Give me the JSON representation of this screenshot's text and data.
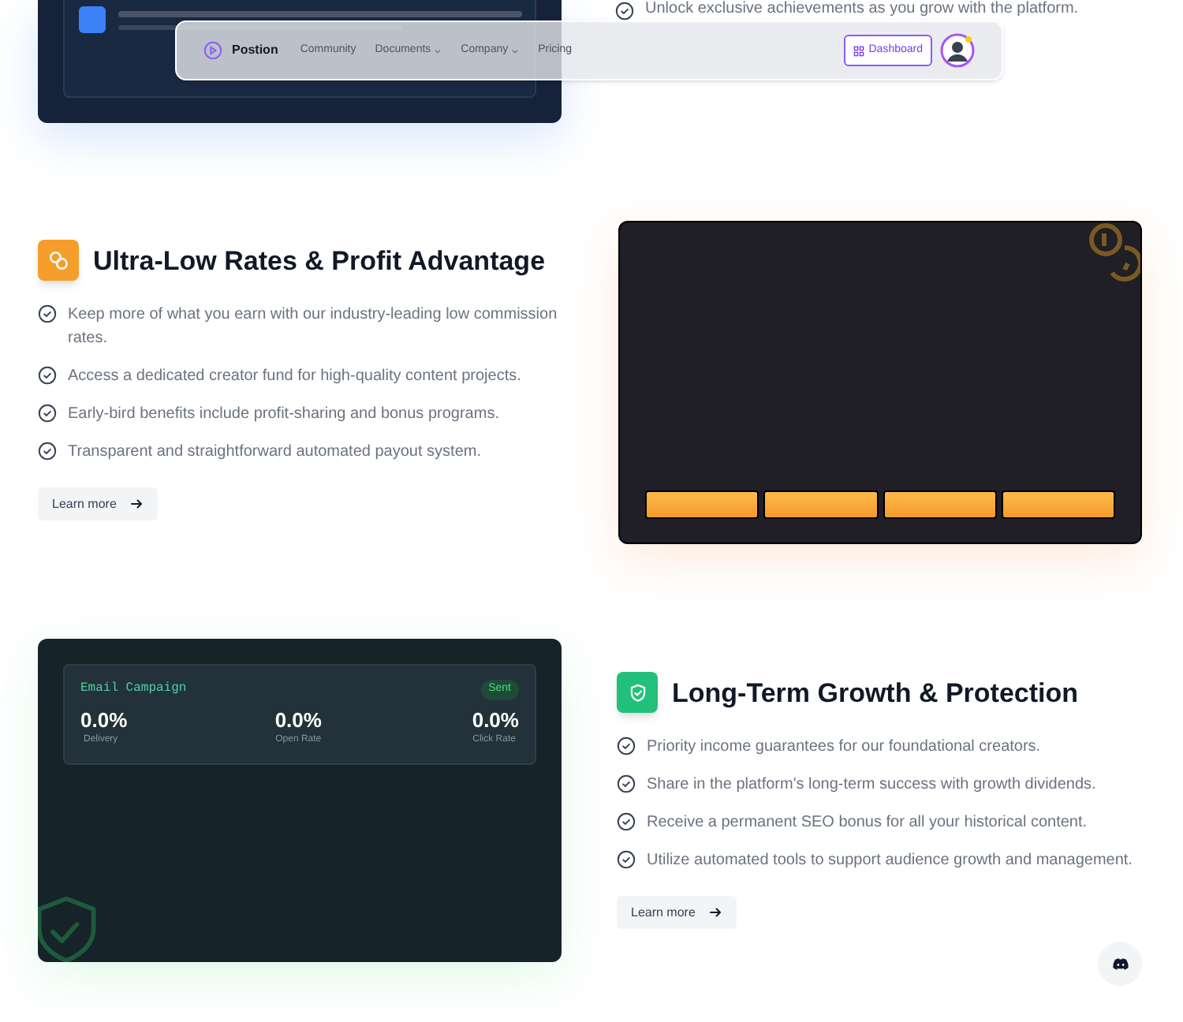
{
  "top_section": {
    "bullets": [
      "Unlock exclusive achievements as you grow with the platform."
    ]
  },
  "navbar": {
    "brand": "Postion",
    "links": [
      {
        "label": "Community",
        "dropdown": false
      },
      {
        "label": "Documents",
        "dropdown": true
      },
      {
        "label": "Company",
        "dropdown": true
      },
      {
        "label": "Pricing",
        "dropdown": false
      }
    ],
    "dashboard_button": "Dashboard"
  },
  "sections": [
    {
      "kind": "rates",
      "title": "Ultra-Low Rates & Profit Advantage",
      "bullets": [
        "Keep more of what you earn with our industry-leading low commission rates.",
        "Access a dedicated creator fund for high-quality content projects.",
        "Early-bird benefits include profit-sharing and bonus programs.",
        "Transparent and straightforward automated payout system."
      ],
      "button": "Learn more"
    },
    {
      "kind": "growth",
      "title": "Long-Term Growth & Protection",
      "bullets": [
        "Priority income guarantees for our foundational creators.",
        "Share in the platform's long-term success with growth dividends.",
        "Receive a permanent SEO bonus for all your historical content.",
        "Utilize automated tools to support audience growth and management."
      ],
      "button": "Learn more",
      "campaign": {
        "title": "Email Campaign",
        "status": "Sent",
        "metrics": [
          {
            "value": "0.0%",
            "label": "Delivery"
          },
          {
            "value": "0.0%",
            "label": "Open Rate"
          },
          {
            "value": "0.0%",
            "label": "Click Rate"
          }
        ]
      }
    }
  ]
}
